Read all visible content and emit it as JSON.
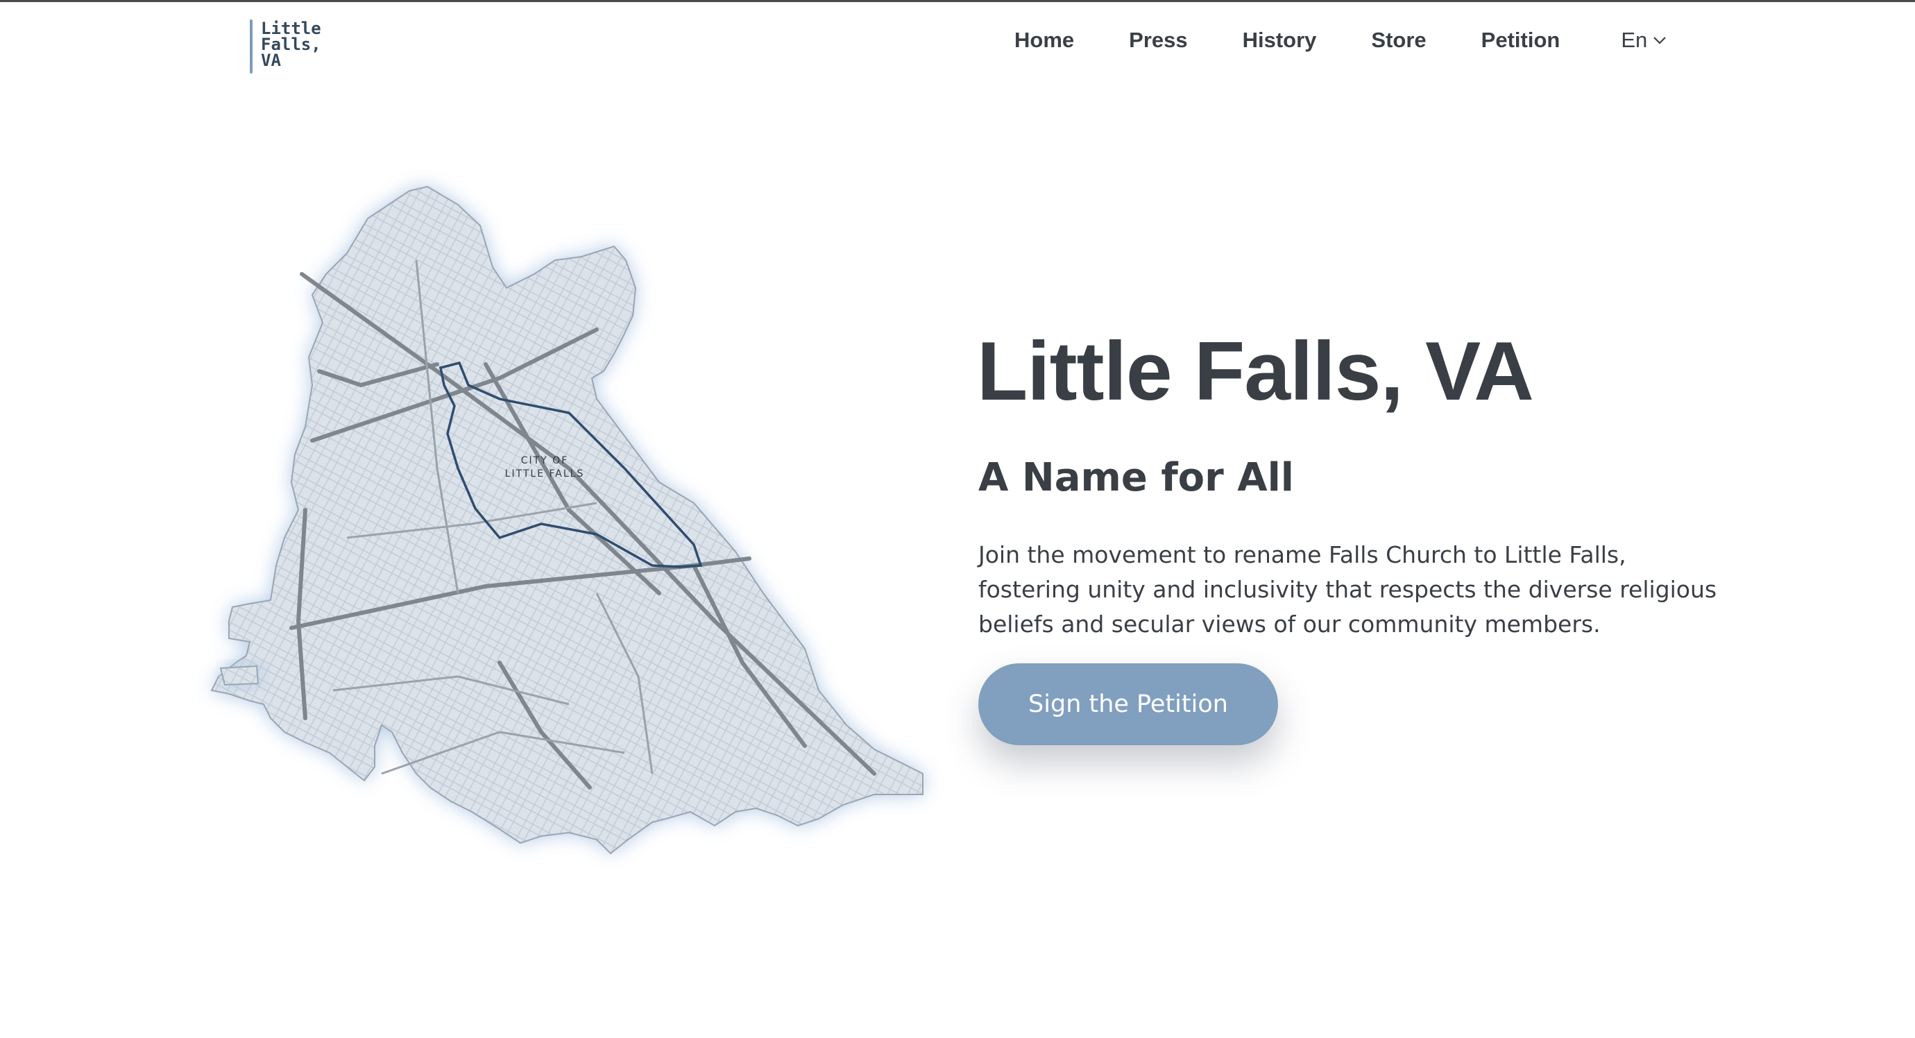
{
  "logo": {
    "text": "Little\nFalls,\nVA"
  },
  "nav": {
    "items": [
      "Home",
      "Press",
      "History",
      "Store",
      "Petition"
    ],
    "language": "En"
  },
  "map": {
    "label_line1": "CITY OF",
    "label_line2": "LITTLE FALLS",
    "colors": {
      "fill": "#d9e1ea",
      "boundary": "#2f4d6e",
      "road": "#8a9097",
      "glow": "#a9c3e2"
    }
  },
  "hero": {
    "title": "Little Falls, VA",
    "subtitle": "A Name for All",
    "description": "Join the movement to rename Falls Church to Little Falls, fostering unity and inclusivity that respects the diverse religious beliefs and secular views of our community members.",
    "cta": "Sign the Petition"
  },
  "colors": {
    "accent": "#819fbf",
    "text": "#3a3f45"
  }
}
